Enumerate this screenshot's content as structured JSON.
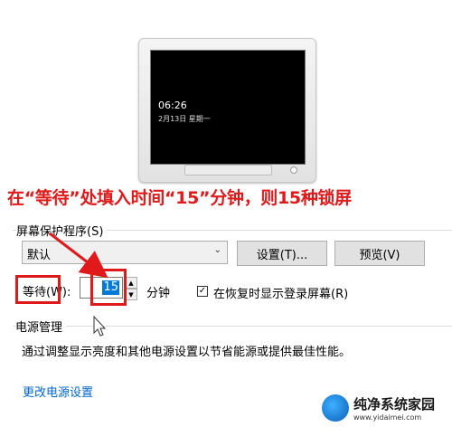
{
  "preview": {
    "time": "06:26",
    "date": "2月13日 星期一"
  },
  "annotation": "在“等待”处填入时间“15”分钟，则15种锁屏",
  "screensaver": {
    "group_label": "屏幕保护程序(S)",
    "selected": "默认",
    "settings_button": "设置(T)...",
    "preview_button": "预览(V)",
    "wait_label": "等待(W):",
    "wait_value": "15",
    "minutes_label": "分钟",
    "resume_checked": true,
    "resume_label": "在恢复时显示登录屏幕(R)"
  },
  "power": {
    "group_label": "电源管理",
    "description": "通过调整显示亮度和其他电源设置以节省能源或提供最佳性能。",
    "link": "更改电源设置"
  },
  "watermark": {
    "name": "纯净系统家园",
    "url": "www.yidaimei.com"
  },
  "colors": {
    "annotation": "#e0191a",
    "selection": "#0078d7",
    "link": "#0066cc"
  }
}
